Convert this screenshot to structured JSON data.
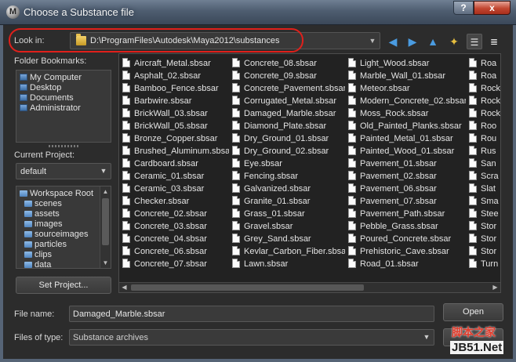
{
  "window": {
    "title": "Choose a Substance file",
    "help_label": "?",
    "close_label": "x"
  },
  "look_in": {
    "label": "Look in:",
    "path": "D:\\ProgramFiles\\Autodesk\\Maya2012\\substances"
  },
  "bookmarks": {
    "label": "Folder Bookmarks:",
    "items": [
      {
        "label": "My Computer"
      },
      {
        "label": "Desktop"
      },
      {
        "label": "Documents"
      },
      {
        "label": "Administrator"
      }
    ]
  },
  "project": {
    "label": "Current Project:",
    "value": "default"
  },
  "project_tree": {
    "items": [
      {
        "label": "Workspace Root"
      },
      {
        "label": "scenes"
      },
      {
        "label": "assets"
      },
      {
        "label": "images"
      },
      {
        "label": "sourceimages"
      },
      {
        "label": "particles"
      },
      {
        "label": "clips"
      },
      {
        "label": "data"
      }
    ]
  },
  "set_project_label": "Set Project...",
  "files": {
    "columns": [
      [
        "Aircraft_Metal.sbsar",
        "Asphalt_02.sbsar",
        "Bamboo_Fence.sbsar",
        "Barbwire.sbsar",
        "BrickWall_03.sbsar",
        "BrickWall_05.sbsar",
        "Bronze_Copper.sbsar",
        "Brushed_Aluminum.sbsar",
        "Cardboard.sbsar",
        "Ceramic_01.sbsar",
        "Ceramic_03.sbsar",
        "Checker.sbsar",
        "Concrete_02.sbsar",
        "Concrete_03.sbsar",
        "Concrete_04.sbsar",
        "Concrete_06.sbsar",
        "Concrete_07.sbsar"
      ],
      [
        "Concrete_08.sbsar",
        "Concrete_09.sbsar",
        "Concrete_Pavement.sbsar",
        "Corrugated_Metal.sbsar",
        "Damaged_Marble.sbsar",
        "Diamond_Plate.sbsar",
        "Dry_Ground_01.sbsar",
        "Dry_Ground_02.sbsar",
        "Eye.sbsar",
        "Fencing.sbsar",
        "Galvanized.sbsar",
        "Granite_01.sbsar",
        "Grass_01.sbsar",
        "Gravel.sbsar",
        "Grey_Sand.sbsar",
        "Kevlar_Carbon_Fiber.sbsar",
        "Lawn.sbsar"
      ],
      [
        "Light_Wood.sbsar",
        "Marble_Wall_01.sbsar",
        "Meteor.sbsar",
        "Modern_Concrete_02.sbsar",
        "Moss_Rock.sbsar",
        "Old_Painted_Planks.sbsar",
        "Painted_Metal_01.sbsar",
        "Painted_Wood_01.sbsar",
        "Pavement_01.sbsar",
        "Pavement_02.sbsar",
        "Pavement_06.sbsar",
        "Pavement_07.sbsar",
        "Pavement_Path.sbsar",
        "Pebble_Grass.sbsar",
        "Poured_Concrete.sbsar",
        "Prehistoric_Cave.sbsar",
        "Road_01.sbsar"
      ],
      [
        "Roa",
        "Roa",
        "Rock",
        "Rock",
        "Rock",
        "Roo",
        "Rou",
        "Rus",
        "San",
        "Scra",
        "Slat",
        "Sma",
        "Stee",
        "Stor",
        "Stor",
        "Stor",
        "Turn"
      ]
    ]
  },
  "file_name": {
    "label": "File name:",
    "value": "Damaged_Marble.sbsar"
  },
  "file_type": {
    "label": "Files of type:",
    "value": "Substance archives"
  },
  "open_label": "Open",
  "watermark": {
    "line1": "脚本之家",
    "line2": "JB51.Net"
  }
}
